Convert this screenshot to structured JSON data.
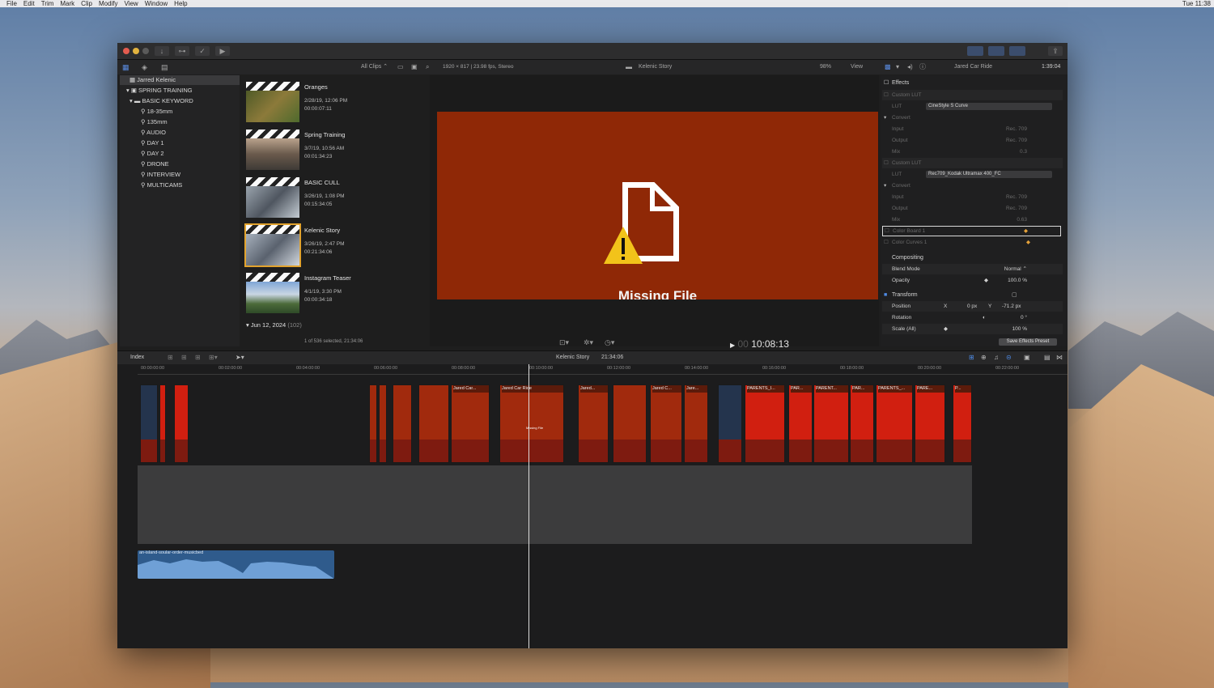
{
  "menubar": {
    "items": [
      "File",
      "Edit",
      "Trim",
      "Mark",
      "Clip",
      "Modify",
      "View",
      "Window",
      "Help"
    ],
    "clock": "Tue 11:38"
  },
  "browser_header": {
    "filter": "All Clips ⌃",
    "format": "1920 × 817 | 23.98 fps, Stereo"
  },
  "library": {
    "items": [
      {
        "label": "Jarred Kelenic",
        "indent": 0,
        "selected": true
      },
      {
        "label": "SPRING TRAINING",
        "indent": 1
      },
      {
        "label": "BASIC KEYWORD",
        "indent": 2
      },
      {
        "label": "18-35mm",
        "indent": 3
      },
      {
        "label": "135mm",
        "indent": 3
      },
      {
        "label": "AUDIO",
        "indent": 3
      },
      {
        "label": "DAY 1",
        "indent": 3
      },
      {
        "label": "DAY 2",
        "indent": 3
      },
      {
        "label": "DRONE",
        "indent": 3
      },
      {
        "label": "INTERVIEW",
        "indent": 3
      },
      {
        "label": "MULTICAMS",
        "indent": 3
      }
    ]
  },
  "clips": [
    {
      "title": "Oranges",
      "date": "2/28/19, 12:06 PM",
      "duration": "00:00:07:11",
      "thumb": "#6a6a2e"
    },
    {
      "title": "Spring Training",
      "date": "3/7/19, 10:56 AM",
      "duration": "00:01:34:23",
      "thumb": "#7c6a5a"
    },
    {
      "title": "BASIC CULL",
      "date": "3/26/19, 1:08 PM",
      "duration": "00:15:34:05",
      "thumb": "#6c7480"
    },
    {
      "title": "Kelenic Story",
      "date": "3/26/19, 2:47 PM",
      "duration": "00:21:34:06",
      "thumb": "#8c96a4",
      "selected": true
    },
    {
      "title": "Instagram Teaser",
      "date": "4/1/19, 3:30 PM",
      "duration": "00:00:34:18",
      "thumb": "#5f7fa8"
    }
  ],
  "browser_footer": {
    "date": "Jun 12, 2024",
    "count": "(102)",
    "selection": "1 of 536 selected, 21:34:06"
  },
  "viewer": {
    "title": "Kelenic Story",
    "zoom": "98%",
    "view": "View",
    "missing": "Missing File",
    "timecode": "10:08:13",
    "timecode_prefix": "00"
  },
  "inspector": {
    "clip_name": "Jared Car Ride",
    "duration": "1:39:04",
    "effects": "Effects",
    "lut1": {
      "title": "Custom LUT",
      "lut_label": "LUT",
      "lut_value": "CineStyle S Curve",
      "convert": "Convert",
      "input": "Input",
      "input_val": "Rec. 709",
      "output": "Output",
      "output_val": "Rec. 709",
      "mix": "Mix",
      "mix_val": "0.3"
    },
    "lut2": {
      "title": "Custom LUT",
      "lut_label": "LUT",
      "lut_value": "Rec709_Kodak Ultramax 400_FC",
      "convert": "Convert",
      "input": "Input",
      "input_val": "Rec. 709",
      "output": "Output",
      "output_val": "Rec. 709",
      "mix": "Mix",
      "mix_val": "0.63"
    },
    "color_board": "Color Board 1",
    "color_curves": "Color Curves 1",
    "compositing": "Compositing",
    "blend_label": "Blend Mode",
    "blend_val": "Normal ⌃",
    "opacity_label": "Opacity",
    "opacity_val": "100.0 %",
    "transform": "Transform",
    "position_label": "Position",
    "pos_x_label": "X",
    "pos_x": "0 px",
    "pos_y_label": "Y",
    "pos_y": "-71.2 px",
    "rotation_label": "Rotation",
    "rotation_val": "0 °",
    "scale_label": "Scale (All)",
    "scale_val": "100 %",
    "save_preset": "Save Effects Preset"
  },
  "timeline": {
    "index": "Index",
    "project": "Kelenic Story",
    "project_duration": "21:34:06",
    "ticks": [
      "00:00:00:00",
      "00:02:00:00",
      "00:04:00:00",
      "00:06:00:00",
      "00:08:00:00",
      "00:10:00:00",
      "00:12:00:00",
      "00:14:00:00",
      "00:16:00:00",
      "00:18:00:00",
      "00:20:00:00",
      "00:22:00:00"
    ],
    "clip_labels": [
      "Jared Car...",
      "Jared Car Ride",
      "Jared...",
      "Jared C...",
      "Jare...",
      "PARENTS_I...",
      "PAR...",
      "PARENT...",
      "PAR...",
      "PARENTS_...",
      "PARE...",
      "P..."
    ],
    "clip_missing": "Missing File",
    "music": "an-island-soular-order-musicbed"
  }
}
